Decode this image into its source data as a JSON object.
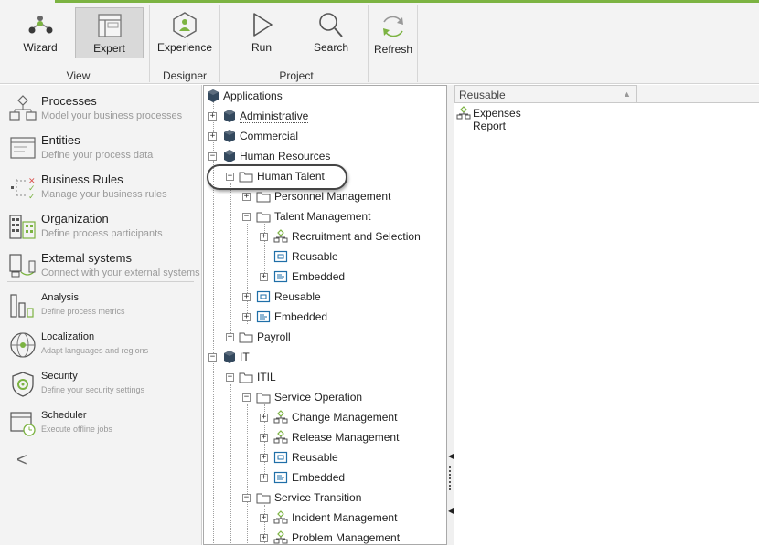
{
  "ribbon": {
    "buttons": {
      "wizard": "Wizard",
      "expert": "Expert",
      "experience": "Experience",
      "run": "Run",
      "search": "Search",
      "refresh": "Refresh"
    },
    "groups": {
      "view": "View",
      "designer": "Designer",
      "project": "Project"
    },
    "accent_color": "#7cb342"
  },
  "leftnav": {
    "items": [
      {
        "title": "Processes",
        "subtitle": "Model your business processes",
        "icon": "processes-icon"
      },
      {
        "title": "Entities",
        "subtitle": "Define your process data",
        "icon": "entities-icon"
      },
      {
        "title": "Business Rules",
        "subtitle": "Manage your business rules",
        "icon": "business-rules-icon"
      },
      {
        "title": "Organization",
        "subtitle": "Define process participants",
        "icon": "organization-icon"
      },
      {
        "title": "External systems",
        "subtitle": "Connect with your external systems",
        "icon": "external-systems-icon"
      },
      {
        "title": "Analysis",
        "subtitle": "Define process metrics",
        "icon": "analysis-icon"
      },
      {
        "title": "Localization",
        "subtitle": "Adapt languages and regions",
        "icon": "localization-icon"
      },
      {
        "title": "Security",
        "subtitle": "Define your security settings",
        "icon": "security-icon"
      },
      {
        "title": "Scheduler",
        "subtitle": "Execute offline jobs",
        "icon": "scheduler-icon"
      }
    ],
    "collapse_glyph": "<"
  },
  "tree": {
    "nodes": [
      {
        "label": "Applications",
        "icon": "cube-icon"
      },
      {
        "label": "Administrative",
        "icon": "cube-icon",
        "expander": "+"
      },
      {
        "label": "Commercial",
        "icon": "cube-icon",
        "expander": "+"
      },
      {
        "label": "Human Resources",
        "icon": "cube-icon",
        "expander": "−"
      },
      {
        "label": "Human Talent",
        "icon": "folder-icon",
        "expander": "−"
      },
      {
        "label": "Personnel Management",
        "icon": "folder-icon",
        "expander": "+"
      },
      {
        "label": "Talent Management",
        "icon": "folder-icon",
        "expander": "−"
      },
      {
        "label": "Recruitment and Selection",
        "icon": "process-icon",
        "expander": "+"
      },
      {
        "label": "Reusable",
        "icon": "subprocess-icon"
      },
      {
        "label": "Embedded",
        "icon": "embedded-icon",
        "expander": "+"
      },
      {
        "label": "Reusable",
        "icon": "subprocess-icon",
        "expander": "+"
      },
      {
        "label": "Embedded",
        "icon": "embedded-icon",
        "expander": "+"
      },
      {
        "label": "Payroll",
        "icon": "folder-icon",
        "expander": "+"
      },
      {
        "label": "IT",
        "icon": "cube-icon",
        "expander": "−"
      },
      {
        "label": "ITIL",
        "icon": "folder-icon",
        "expander": "−"
      },
      {
        "label": "Service Operation",
        "icon": "folder-icon",
        "expander": "−"
      },
      {
        "label": "Change Management",
        "icon": "process-icon",
        "expander": "+"
      },
      {
        "label": "Release Management",
        "icon": "process-icon",
        "expander": "+"
      },
      {
        "label": "Reusable",
        "icon": "subprocess-icon",
        "expander": "+"
      },
      {
        "label": "Embedded",
        "icon": "embedded-icon",
        "expander": "+"
      },
      {
        "label": "Service Transition",
        "icon": "folder-icon",
        "expander": "−"
      },
      {
        "label": "Incident Management",
        "icon": "process-icon",
        "expander": "+"
      },
      {
        "label": "Problem Management",
        "icon": "process-icon",
        "expander": "+"
      }
    ]
  },
  "rpanel": {
    "column_header": "Reusable",
    "items": [
      {
        "label": "Expenses Report",
        "icon": "process-icon"
      }
    ]
  }
}
